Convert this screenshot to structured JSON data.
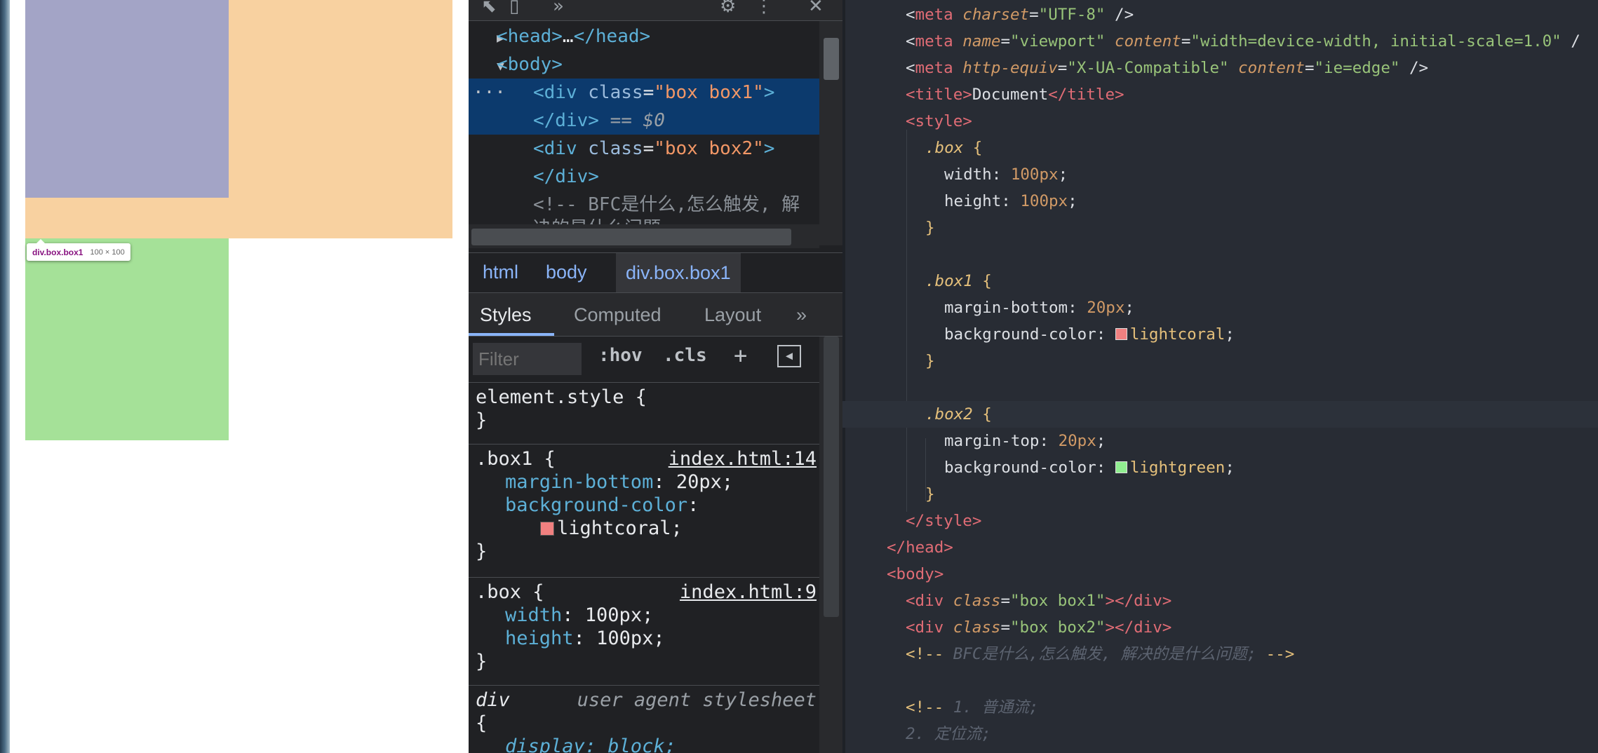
{
  "colors": {
    "box1_purple": "#a3a4c6",
    "margin_orange": "#f8d1a0",
    "box2_green": "#a5e198",
    "devtools_bg": "#202124",
    "selected_row": "#0c3a6d",
    "editor_bg": "#282c34",
    "lightcoral": "#f08080",
    "lightgreen": "#90ee90"
  },
  "page": {
    "tooltip": {
      "selector": "div.box.box1",
      "dimensions": "100 × 100"
    }
  },
  "devtools": {
    "toolbar_icons": [
      "inspect-icon",
      "device-toggle-icon",
      "more-tabs-icon",
      "gear-icon",
      "kebab-menu-icon",
      "close-icon"
    ],
    "elements": {
      "head_open": "<head>",
      "head_ellipsis": "…",
      "head_close": "</head>",
      "body_open": "<body>",
      "div1_tag": "div",
      "div1_class_attr": "class",
      "div1_class_value": "\"box box1\"",
      "div_close": "</div>",
      "selected_marker": "== $0",
      "div2_class_value": "\"box box2\"",
      "comment_line1": "<!-- BFC是什么,怎么触发, 解",
      "comment_line2": "决的是什么问题"
    },
    "breadcrumbs": [
      "html",
      "body",
      "div.box.box1"
    ],
    "tabs": [
      "Styles",
      "Computed",
      "Layout",
      "»"
    ],
    "filter": {
      "placeholder": "Filter",
      "hov": ":hov",
      "cls": ".cls",
      "plus": "+"
    },
    "rules": {
      "element_style": "element.style {",
      "close_brace": "}",
      "box1_selector": ".box1 {",
      "box1_source": "index.html:14",
      "box1_margin_name": "margin-bottom",
      "box1_margin_value": ": 20px;",
      "box1_bg_name": "background-color",
      "box1_bg_colon": ":",
      "box1_bg_value": "lightcoral;",
      "box_selector": ".box {",
      "box_source": "index.html:9",
      "box_width_name": "width",
      "box_width_value": ": 100px;",
      "box_height_name": "height",
      "box_height_value": ": 100px;",
      "ua_selector": "div",
      "ua_label": "user agent stylesheet",
      "ua_open": "{",
      "ua_display": "display: block;"
    }
  },
  "editor": {
    "l_meta_charset": {
      "lt": "<",
      "tag": "meta",
      "attr": "charset",
      "eq": "=",
      "val": "\"UTF-8\"",
      "end": " />"
    },
    "l_meta_viewport": {
      "lt": "<",
      "tag": "meta",
      "attr1": "name",
      "val1": "\"viewport\"",
      "attr2": "content",
      "val2": "\"width=device-width, initial-scale=1.0\"",
      "end": " /"
    },
    "l_meta_compat": {
      "lt": "<",
      "tag": "meta",
      "attr1": "http-equiv",
      "val1": "\"X-UA-Compatible\"",
      "attr2": "content",
      "val2": "\"ie=edge\"",
      "end": " />"
    },
    "l_title": {
      "open": "<title>",
      "text": "Document",
      "close": "</title>"
    },
    "l_style_open": "<style>",
    "l_box_sel": ".box",
    "l_brace_open": "{",
    "l_width_prop": "width: ",
    "l_width_val": "100px",
    "l_height_prop": "height: ",
    "l_height_val": "100px",
    "l_semi": ";",
    "l_brace_close": "}",
    "l_box1_sel": ".box1",
    "l_mb_prop": "margin-bottom: ",
    "l_mb_val": "20px",
    "l_bg_prop": "background-color: ",
    "l_bg1_val": "lightcoral",
    "l_box2_sel": ".box2",
    "l_mt_prop": "margin-top: ",
    "l_mt_val": "20px",
    "l_bg2_val": "lightgreen",
    "l_style_close": "</style>",
    "l_head_close": "</head>",
    "l_body_open": "<body>",
    "l_div1": {
      "lt": "<",
      "tag": "div",
      "attr": "class",
      "eq": "=",
      "val": "\"box box1\"",
      "gt": ">",
      "close": "</div>"
    },
    "l_div2": {
      "lt": "<",
      "tag": "div",
      "attr": "class",
      "eq": "=",
      "val": "\"box box2\"",
      "gt": ">",
      "close": "</div>"
    },
    "l_comment1": {
      "open": "<!--",
      "text": " BFC是什么,怎么触发, 解决的是什么问题; ",
      "close": "-->"
    },
    "l_comment2": {
      "open": "<!--",
      "text": " 1. 普通流;"
    },
    "l_comment3": "2. 定位流;"
  }
}
